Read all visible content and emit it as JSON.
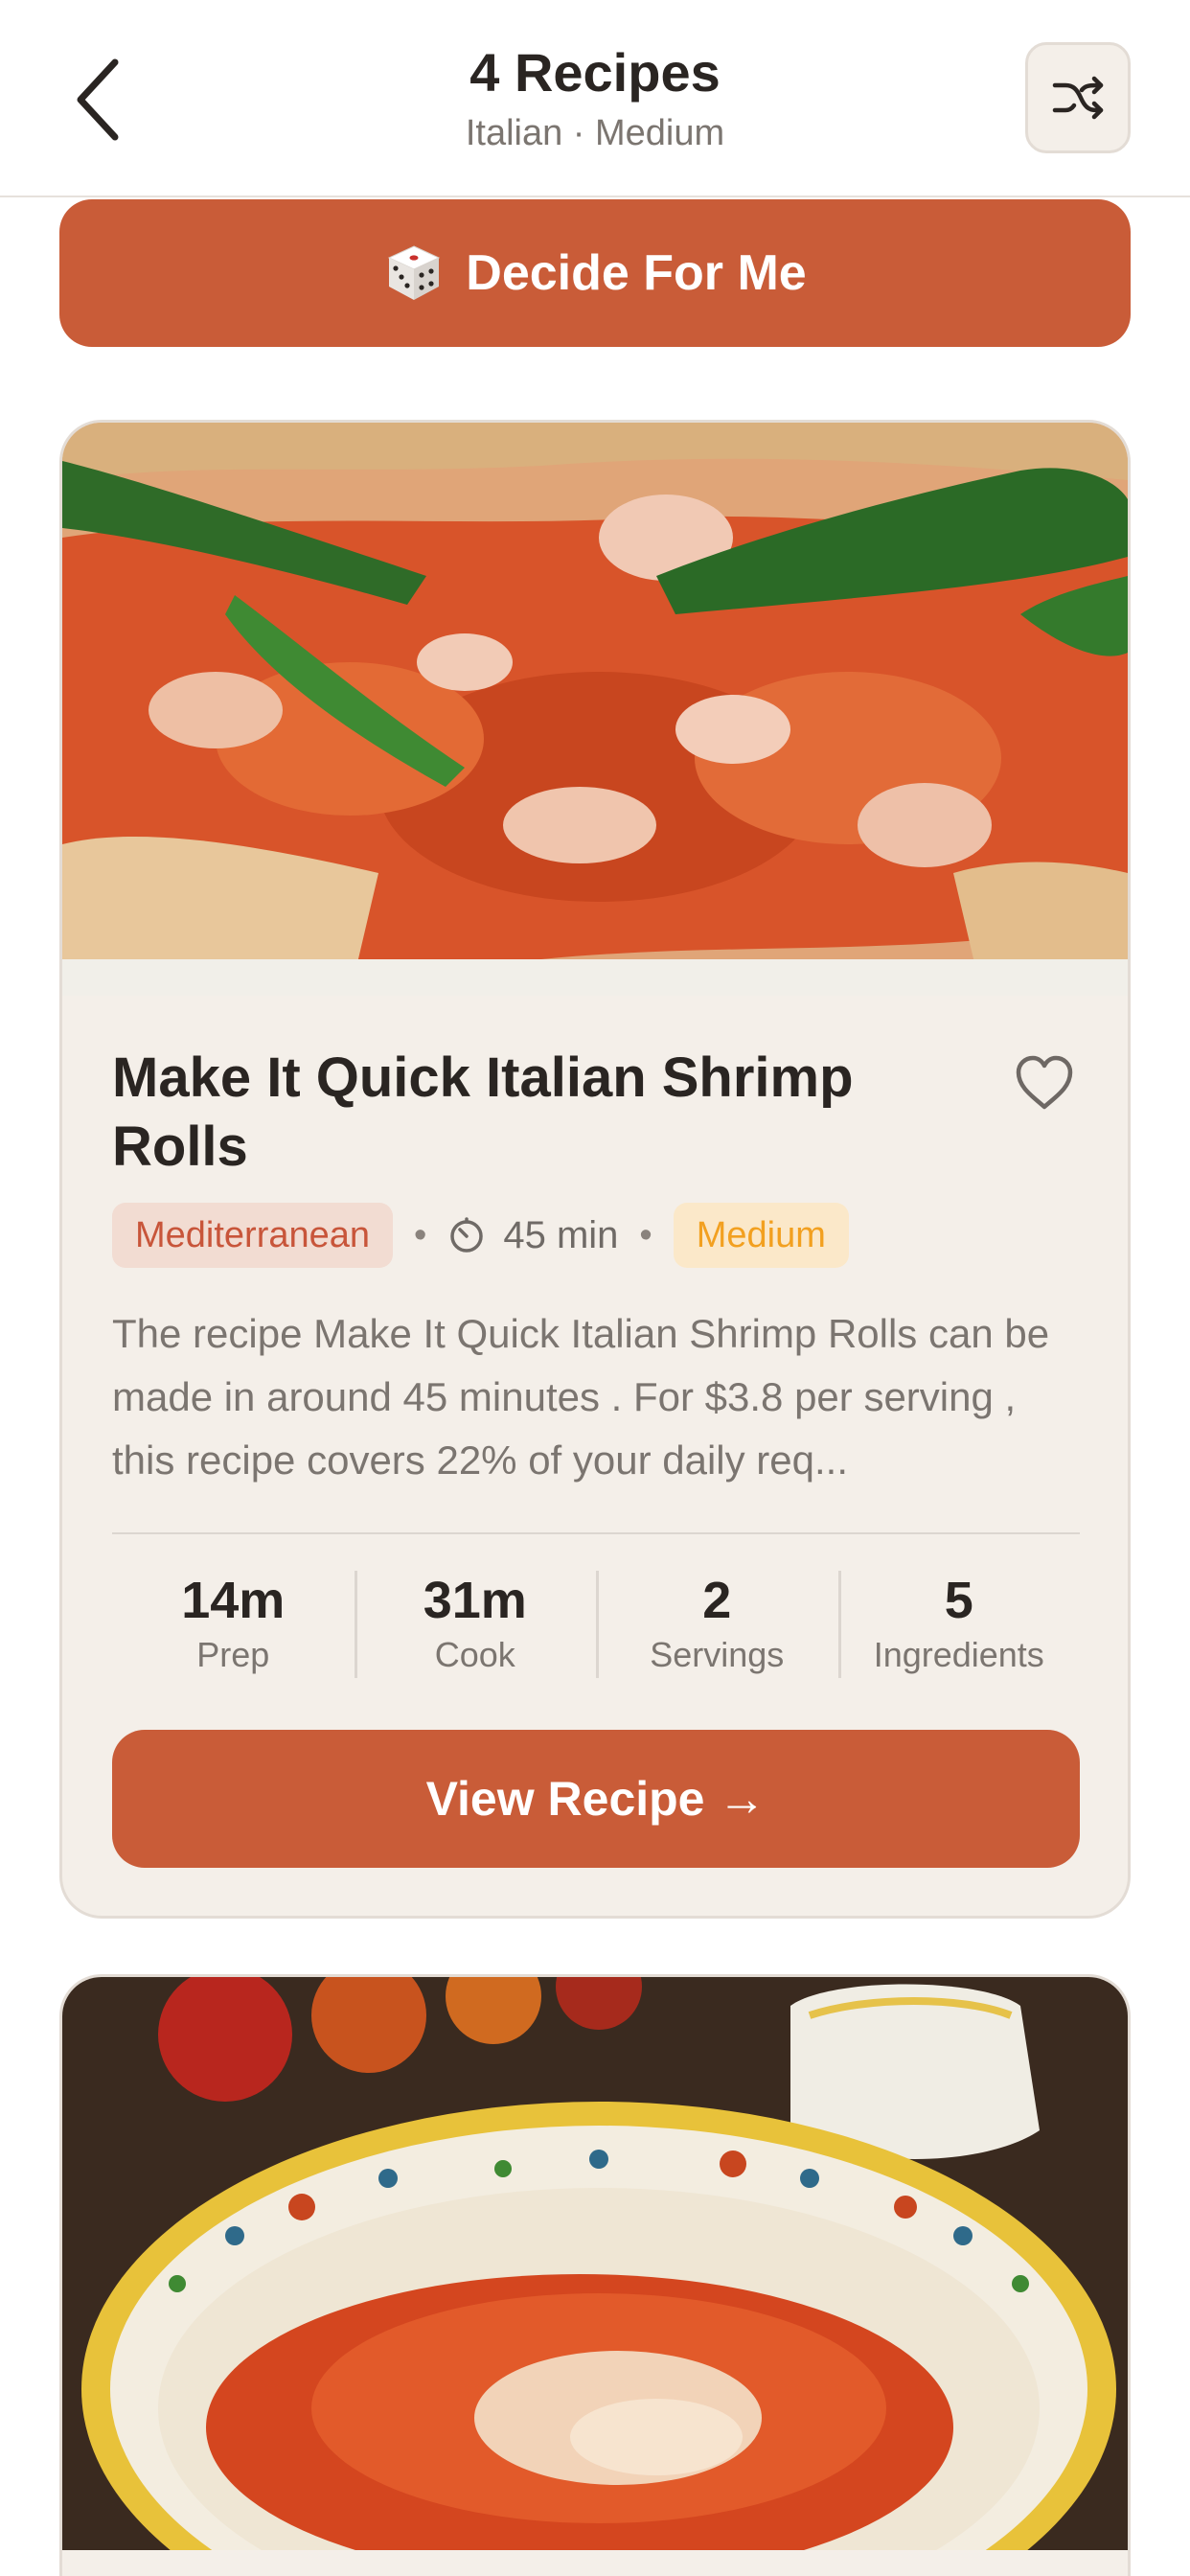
{
  "header": {
    "title": "4 Recipes",
    "subtitle": "Italian · Medium",
    "back_icon": "chevron-left-icon",
    "shuffle_icon": "shuffle-icon"
  },
  "decide_button": {
    "label": "Decide For Me",
    "icon": "dice-icon"
  },
  "recipes": [
    {
      "title": "Make It Quick Italian Shrimp Rolls",
      "cuisine": "Mediterranean",
      "time": "45 min",
      "difficulty": "Medium",
      "description": "The recipe Make It Quick Italian Shrimp Rolls can be made in around 45 minutes . For $3.8 per serving , this recipe covers 22% of your daily req...",
      "stats": [
        {
          "value": "14m",
          "label": "Prep"
        },
        {
          "value": "31m",
          "label": "Cook"
        },
        {
          "value": "2",
          "label": "Servings"
        },
        {
          "value": "5",
          "label": "Ingredients"
        }
      ],
      "view_label": "View Recipe →",
      "favorite_icon": "heart-outline-icon"
    }
  ],
  "colors": {
    "accent": "#c95c38",
    "card_bg": "#f4efe9",
    "cuisine_badge_bg": "#f2dcd2",
    "cuisine_badge_text": "#c8553a",
    "difficulty_badge_bg": "#fbe8c9",
    "difficulty_badge_text": "#f2a020"
  }
}
